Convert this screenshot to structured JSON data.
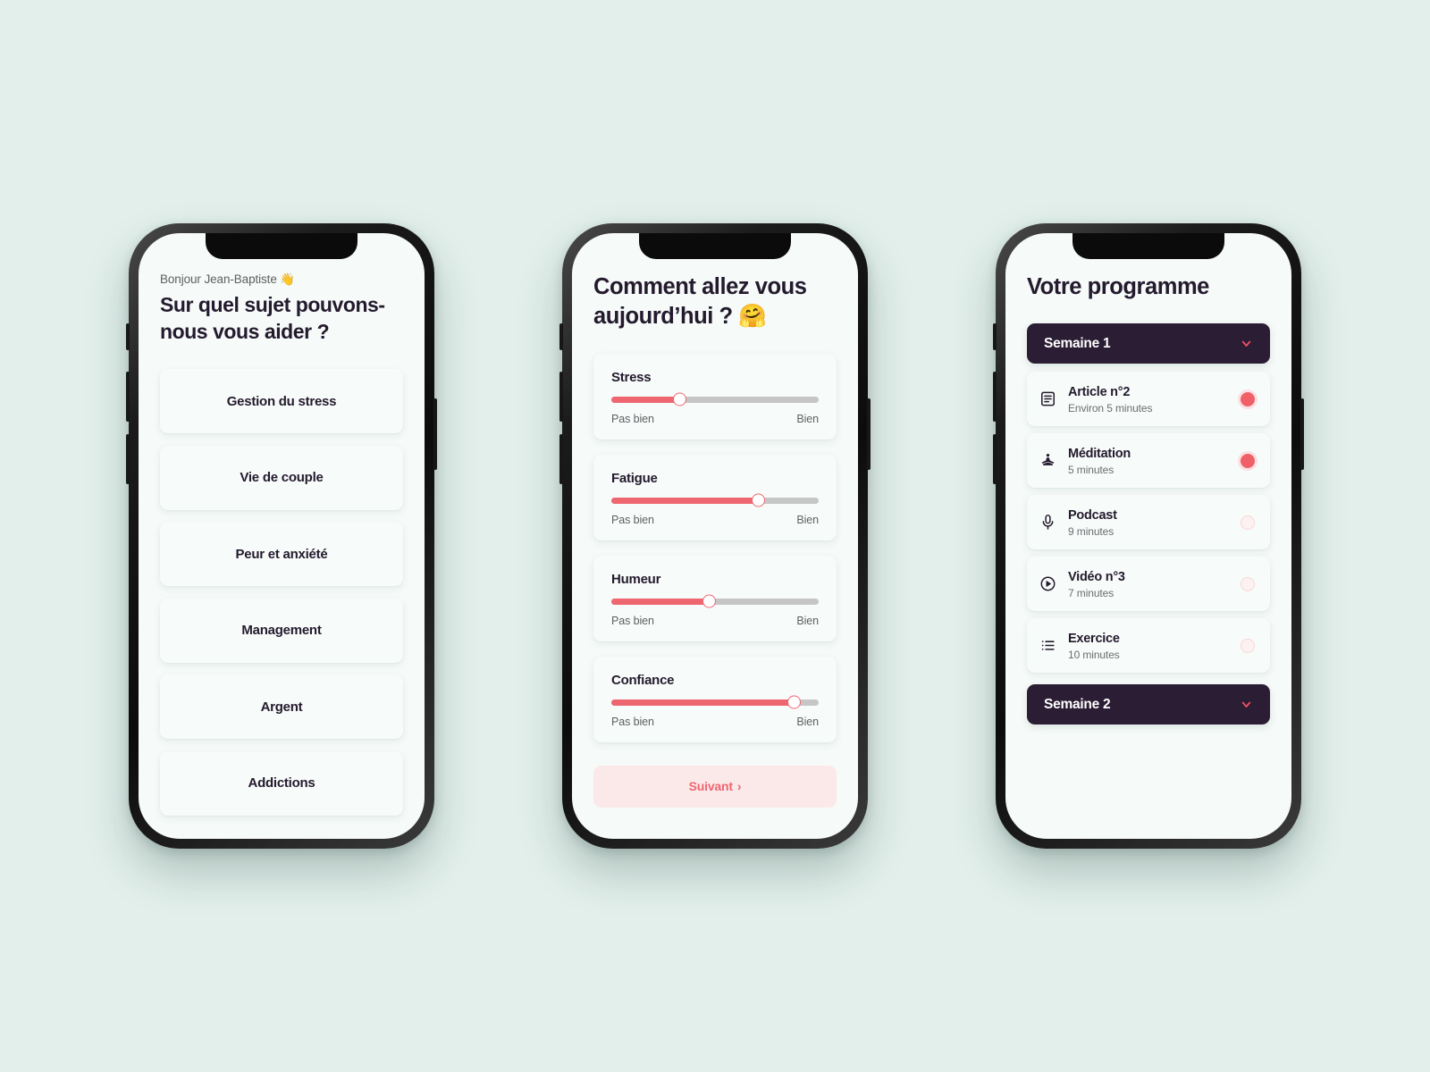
{
  "background_color": "#e2efeb",
  "accent_color": "#ee6670",
  "dark_color": "#2b1d33",
  "phone1": {
    "greeting": "Bonjour Jean-Baptiste 👋",
    "title": "Sur quel sujet pouvons-nous vous aider ?",
    "topics": [
      {
        "label": "Gestion du stress"
      },
      {
        "label": "Vie de couple"
      },
      {
        "label": "Peur et anxiété"
      },
      {
        "label": "Management"
      },
      {
        "label": "Argent"
      },
      {
        "label": "Addictions"
      }
    ]
  },
  "phone2": {
    "title": "Comment allez vous aujourd’hui ? 🤗",
    "legend_low": "Pas bien",
    "legend_high": "Bien",
    "sliders": [
      {
        "name": "Stress",
        "value": 33
      },
      {
        "name": "Fatigue",
        "value": 71
      },
      {
        "name": "Humeur",
        "value": 47
      },
      {
        "name": "Confiance",
        "value": 88
      }
    ],
    "next_label": "Suivant",
    "next_chevron": "›"
  },
  "phone3": {
    "title": "Votre programme",
    "weeks": [
      {
        "label": "Semaine 1",
        "expanded": true,
        "chevron_icon": "chevron-down-icon",
        "items": [
          {
            "icon": "article-icon",
            "title": "Article n°2",
            "duration": "Environ 5 minutes",
            "status": "done"
          },
          {
            "icon": "meditation-icon",
            "title": "Méditation",
            "duration": "5 minutes",
            "status": "done"
          },
          {
            "icon": "microphone-icon",
            "title": "Podcast",
            "duration": "9 minutes",
            "status": "todo"
          },
          {
            "icon": "play-icon",
            "title": "Vidéo n°3",
            "duration": "7 minutes",
            "status": "todo"
          },
          {
            "icon": "list-icon",
            "title": "Exercice",
            "duration": "10 minutes",
            "status": "todo"
          }
        ]
      },
      {
        "label": "Semaine 2",
        "expanded": false,
        "chevron_icon": "chevron-down-icon",
        "items": []
      }
    ]
  }
}
